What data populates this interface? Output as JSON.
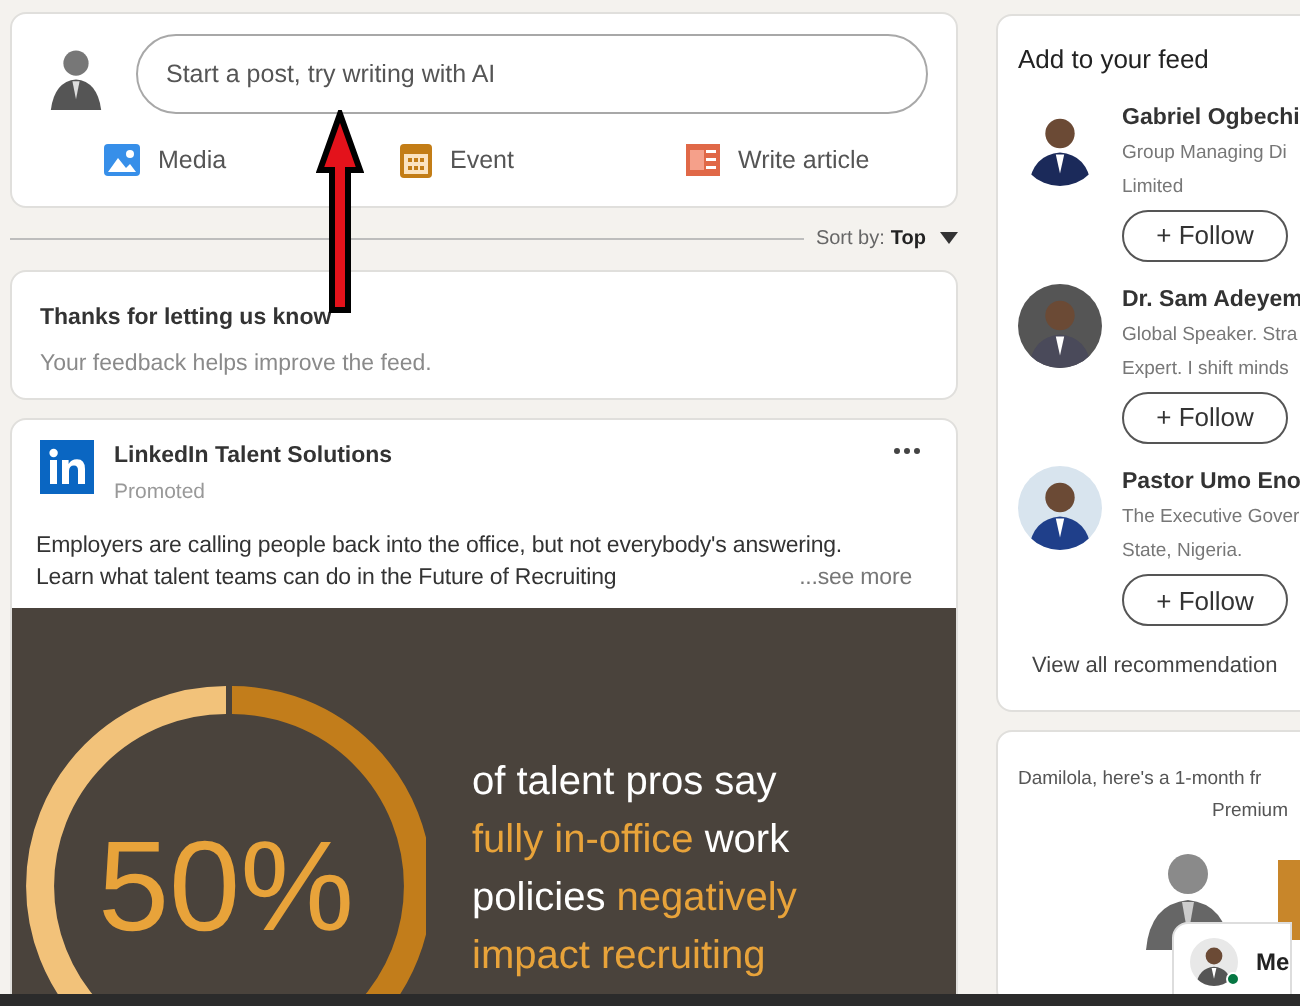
{
  "composer": {
    "placeholder": "Start a post, try writing with AI",
    "actions": [
      {
        "kind": "media",
        "label": "Media"
      },
      {
        "kind": "event",
        "label": "Event"
      },
      {
        "kind": "article",
        "label": "Write article"
      }
    ]
  },
  "sort": {
    "label": "Sort by:",
    "value": "Top"
  },
  "feedback": {
    "title": "Thanks for letting us know",
    "text": "Your feedback helps improve the feed."
  },
  "ad": {
    "company": "LinkedIn Talent Solutions",
    "tag": "Promoted",
    "body_lines": [
      "Employers are calling people back into the office, but not everybody's answering.",
      "Learn what talent teams can do in the Future of Recruiting"
    ],
    "more": "...see more",
    "image": {
      "stat": "50%",
      "lines": [
        [
          {
            "text": "of talent pros say",
            "highlight": false
          }
        ],
        [
          {
            "text": "fully in-office",
            "highlight": true
          },
          {
            "text": " work",
            "highlight": false
          }
        ],
        [
          {
            "text": "policies ",
            "highlight": false
          },
          {
            "text": "negatively",
            "highlight": true
          }
        ],
        [
          {
            "text": "impact recruiting",
            "highlight": true
          }
        ]
      ]
    }
  },
  "feed_panel": {
    "title": "Add to your feed",
    "people": [
      {
        "name": "Gabriel Ogbechi",
        "headline": [
          "Group Managing Di",
          "Limited"
        ],
        "follow": "+ Follow"
      },
      {
        "name": "Dr. Sam Adeyem",
        "headline": [
          "Global Speaker. Stra",
          "Expert. I shift minds"
        ],
        "follow": "+ Follow"
      },
      {
        "name": "Pastor Umo Eno",
        "headline": [
          "The Executive Gover",
          "State, Nigeria."
        ],
        "follow": "+ Follow"
      }
    ],
    "view_all": "View all recommendation"
  },
  "premium": {
    "text": "Damilola, here's a 1-month fr",
    "subtitle": "Premium"
  },
  "messaging": {
    "label": "Me",
    "online": true
  }
}
